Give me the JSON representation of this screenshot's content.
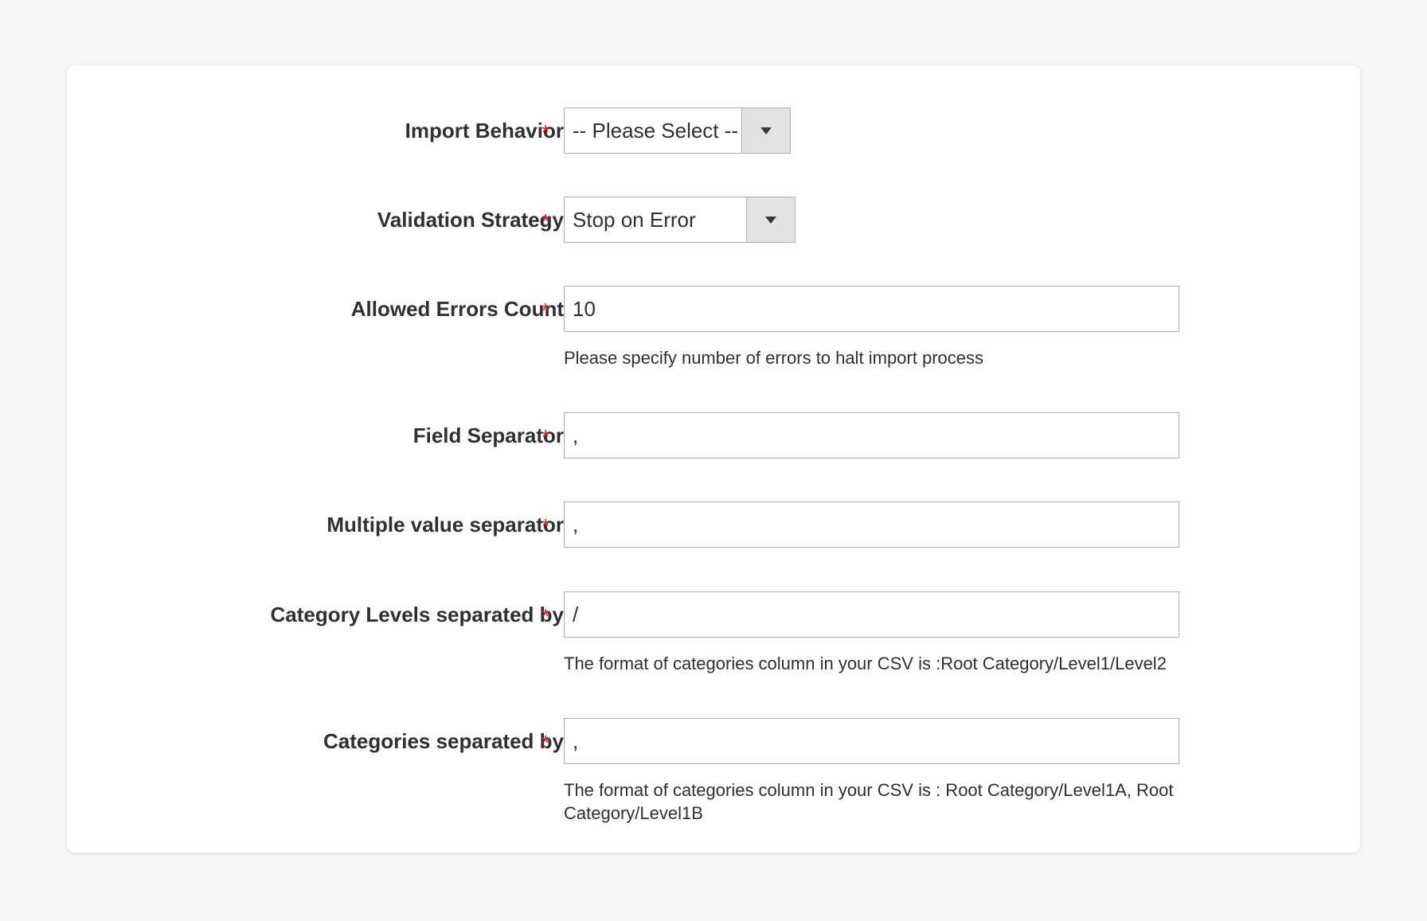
{
  "form": {
    "import_behavior": {
      "label": "Import Behavior",
      "required_mark": "*",
      "value": "-- Please Select --"
    },
    "validation_strategy": {
      "label": "Validation Strategy",
      "required_mark": "*",
      "value": "Stop on Error"
    },
    "allowed_errors_count": {
      "label": "Allowed Errors Count",
      "required_mark": "*",
      "value": "10",
      "note": "Please specify number of errors to halt import process"
    },
    "field_separator": {
      "label": "Field Separator",
      "required_mark": "*",
      "value": ","
    },
    "multiple_value_separator": {
      "label": "Multiple value separator",
      "required_mark": "*",
      "value": ","
    },
    "category_levels_separator": {
      "label": "Category Levels separated by",
      "required_mark": "*",
      "value": "/",
      "note": "The format of categories column in your CSV is :Root Category/Level1/Level2"
    },
    "categories_separator": {
      "label": "Categories separated by",
      "required_mark": "*",
      "value": ",",
      "note": "The format of categories column in your CSV is : Root Category/Level1A, Root Category/Level1B"
    }
  },
  "colors": {
    "page_background": "#f6f6f6",
    "card_background": "#ffffff",
    "required_mark": "#e22626",
    "border": "#adadad",
    "select_button": "#e3e3e3",
    "text": "#303030"
  },
  "icons": {
    "select_arrow": "chevron-down-icon"
  }
}
